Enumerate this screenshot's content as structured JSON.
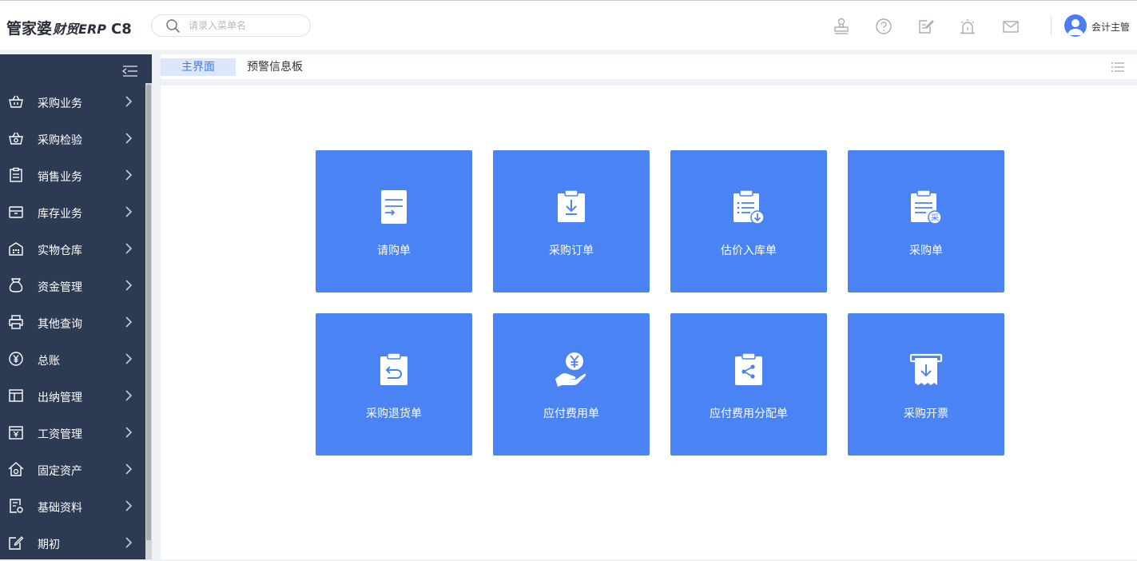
{
  "header": {
    "logo_main": "管家婆",
    "logo_sub": "财贸ERP",
    "logo_version": "C8",
    "search_placeholder": "请录入菜单名",
    "icons": [
      "stamp-icon",
      "help-icon",
      "edit-note-icon",
      "alarm-icon",
      "mail-icon"
    ],
    "user_name": "会计主管"
  },
  "sidebar": {
    "items": [
      {
        "label": "采购业务",
        "icon": "basket-icon"
      },
      {
        "label": "采购检验",
        "icon": "inspect-basket-icon"
      },
      {
        "label": "销售业务",
        "icon": "clipboard-icon"
      },
      {
        "label": "库存业务",
        "icon": "inventory-icon"
      },
      {
        "label": "实物仓库",
        "icon": "warehouse-icon"
      },
      {
        "label": "资金管理",
        "icon": "money-bag-icon"
      },
      {
        "label": "其他查询",
        "icon": "printer-icon"
      },
      {
        "label": "总账",
        "icon": "yen-circle-icon"
      },
      {
        "label": "出纳管理",
        "icon": "layout-icon"
      },
      {
        "label": "工资管理",
        "icon": "payroll-icon"
      },
      {
        "label": "固定资产",
        "icon": "home-icon"
      },
      {
        "label": "基础资料",
        "icon": "document-settings-icon"
      },
      {
        "label": "期初",
        "icon": "edit-icon"
      }
    ]
  },
  "tabs": [
    {
      "label": "主界面",
      "active": true
    },
    {
      "label": "预警信息板",
      "active": false
    }
  ],
  "tiles": [
    {
      "label": "请购单",
      "icon": "requisition-icon"
    },
    {
      "label": "采购订单",
      "icon": "purchase-order-icon"
    },
    {
      "label": "估价入库单",
      "icon": "estimated-receipt-icon"
    },
    {
      "label": "采购单",
      "icon": "purchase-bill-icon"
    },
    {
      "label": "采购退货单",
      "icon": "purchase-return-icon"
    },
    {
      "label": "应付费用单",
      "icon": "payable-expense-icon"
    },
    {
      "label": "应付费用分配单",
      "icon": "expense-allocation-icon"
    },
    {
      "label": "采购开票",
      "icon": "purchase-invoice-icon"
    }
  ],
  "colors": {
    "sidebar_bg": "#2d3a54",
    "tile_bg": "#4a83f4",
    "accent": "#3a7af0",
    "active_tab_bg": "#dde7fb"
  }
}
